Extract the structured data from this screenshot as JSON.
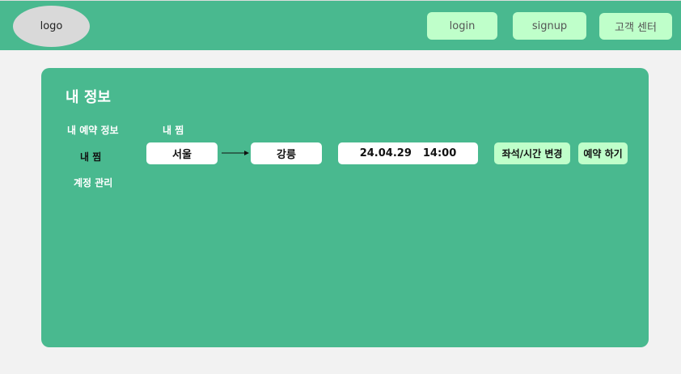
{
  "header": {
    "logo_text": "logo",
    "login_label": "login",
    "signup_label": "signup",
    "support_label": "고객 센터"
  },
  "panel": {
    "title": "내 정보",
    "sidebar": {
      "items": [
        {
          "label": "내 예약 정보",
          "active": false
        },
        {
          "label": "내 찜",
          "active": true
        },
        {
          "label": "계정 관리",
          "active": false
        }
      ]
    },
    "section_title": "내 찜",
    "wish_item": {
      "from": "서울",
      "to": "강릉",
      "date": "24.04.29",
      "time": "14:00",
      "change_button": "좌석/시간 변경",
      "reserve_button": "예약 하기"
    }
  },
  "colors": {
    "brand_green": "#49b98f",
    "button_light_green": "#bfffca",
    "page_background": "#f2f2f2"
  }
}
